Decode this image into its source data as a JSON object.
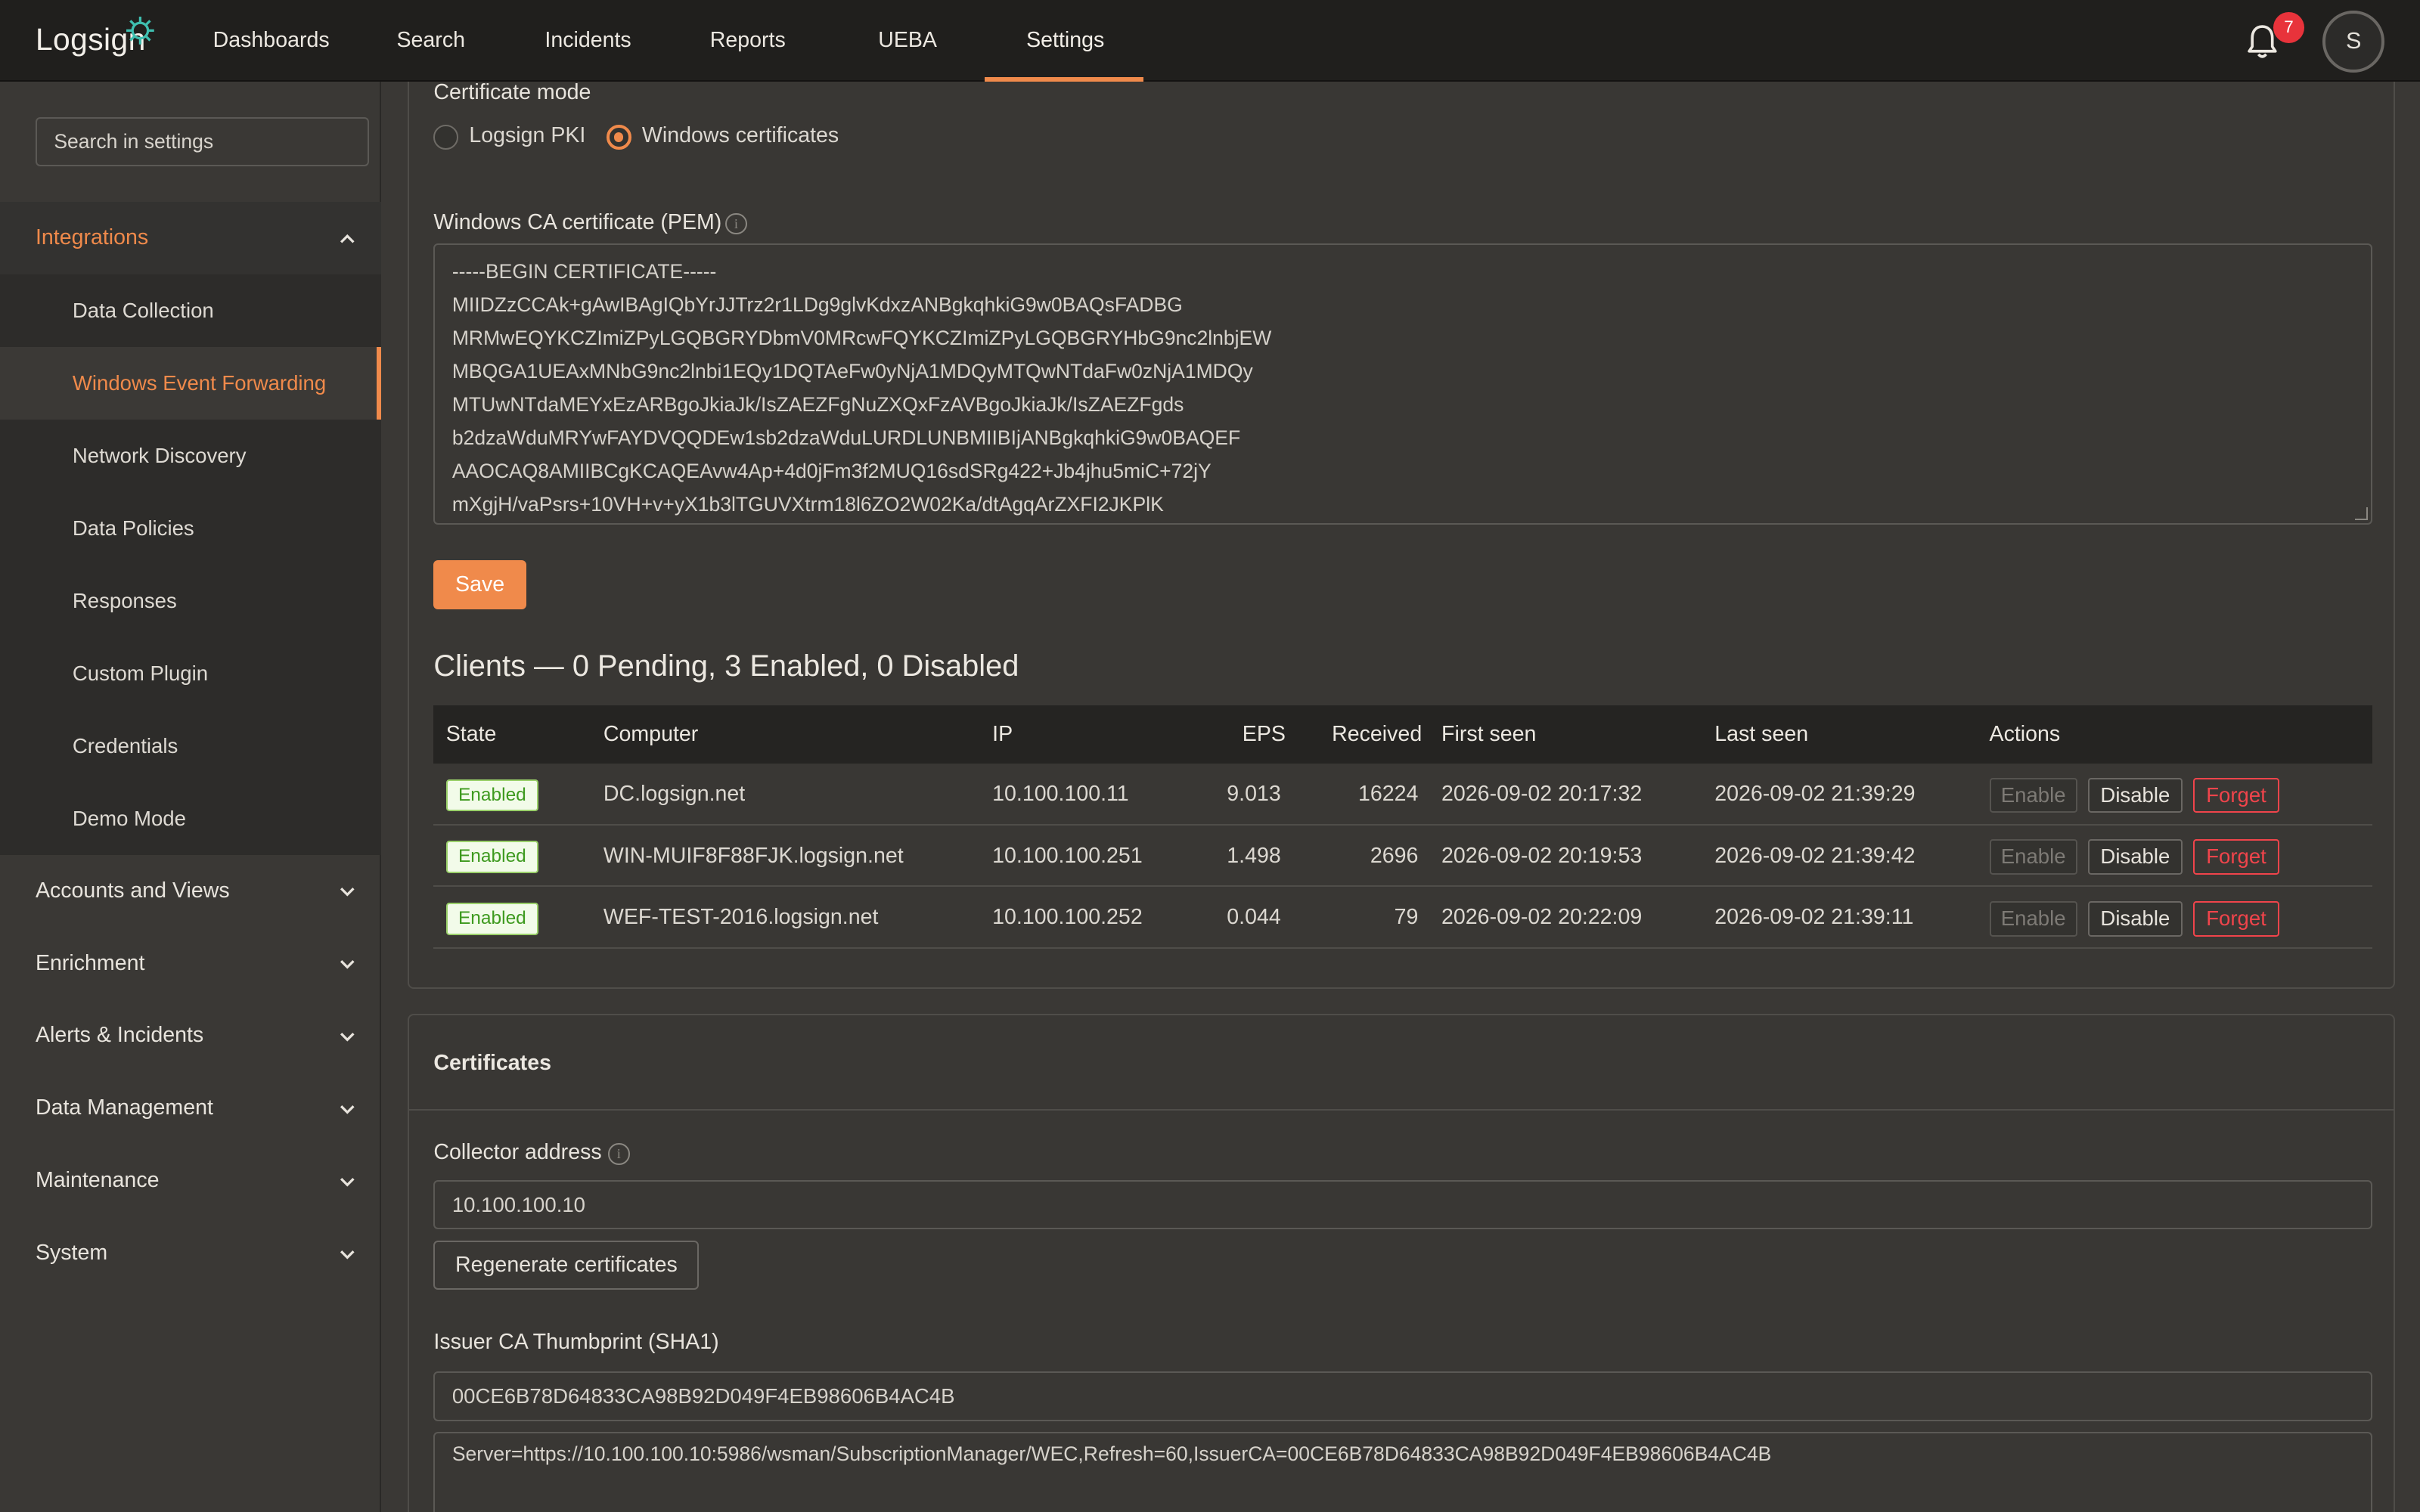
{
  "app": {
    "logo_text": "Logsign",
    "notifications_count": "7",
    "user_initial": "S"
  },
  "nav": {
    "items": [
      "Dashboards",
      "Search",
      "Incidents",
      "Reports",
      "UEBA",
      "Settings"
    ],
    "active": "Settings"
  },
  "sidebar": {
    "search_placeholder": "Search in settings",
    "integrations_label": "Integrations",
    "integrations_items": [
      "Data Collection",
      "Windows Event Forwarding",
      "Network Discovery",
      "Data Policies",
      "Responses",
      "Custom Plugin",
      "Credentials",
      "Demo Mode"
    ],
    "groups": [
      "Accounts and Views",
      "Enrichment",
      "Alerts & Incidents",
      "Data Management",
      "Maintenance",
      "System"
    ]
  },
  "cert_mode": {
    "label": "Certificate mode",
    "option_pki": "Logsign PKI",
    "option_windows": "Windows certificates",
    "selected": "Windows certificates"
  },
  "pem": {
    "label": "Windows CA certificate (PEM)",
    "lines": [
      "-----BEGIN CERTIFICATE-----",
      "MIIDZzCCAk+gAwIBAgIQbYrJJTrz2r1LDg9glvKdxzANBgkqhkiG9w0BAQsFADBG",
      "MRMwEQYKCZImiZPyLGQBGRYDbmV0MRcwFQYKCZImiZPyLGQBGRYHbG9nc2lnbjEW",
      "MBQGA1UEAxMNbG9nc2lnbi1EQy1DQTAeFw0yNjA1MDQyMTQwNTdaFw0zNjA1MDQy",
      "MTUwNTdaMEYxEzARBgoJkiaJk/IsZAEZFgNuZXQxFzAVBgoJkiaJk/IsZAEZFgds",
      "b2dzaWduMRYwFAYDVQQDEw1sb2dzaWduLURDLUNBMIIBIjANBgkqhkiG9w0BAQEF",
      "AAOCAQ8AMIIBCgKCAQEAvw4Ap+4d0jFm3f2MUQ16sdSRg422+Jb4jhu5miC+72jY",
      "mXgjH/vaPsrs+10VH+v+yX1b3lTGUVXtrm18l6ZO2W02Ka/dtAgqArZXFI2JKPlK"
    ]
  },
  "save_label": "Save",
  "clients": {
    "title": "Clients — 0 Pending, 3 Enabled, 0 Disabled",
    "columns": [
      "State",
      "Computer",
      "IP",
      "EPS",
      "Received",
      "First seen",
      "Last seen",
      "Actions"
    ],
    "rows": [
      {
        "state": "Enabled",
        "computer": "DC.logsign.net",
        "ip": "10.100.100.11",
        "eps": "9.013",
        "received": "16224",
        "first_seen": "2026-09-02 20:17:32",
        "last_seen": "2026-09-02 21:39:29"
      },
      {
        "state": "Enabled",
        "computer": "WIN-MUIF8F88FJK.logsign.net",
        "ip": "10.100.100.251",
        "eps": "1.498",
        "received": "2696",
        "first_seen": "2026-09-02 20:19:53",
        "last_seen": "2026-09-02 21:39:42"
      },
      {
        "state": "Enabled",
        "computer": "WEF-TEST-2016.logsign.net",
        "ip": "10.100.100.252",
        "eps": "0.044",
        "received": "79",
        "first_seen": "2026-09-02 20:22:09",
        "last_seen": "2026-09-02 21:39:11"
      }
    ],
    "action_labels": {
      "enable": "Enable",
      "disable": "Disable",
      "forget": "Forget"
    }
  },
  "certificates": {
    "title": "Certificates",
    "collector_label": "Collector address",
    "collector_value": "10.100.100.10",
    "regen_label": "Regenerate certificates",
    "thumb_label": "Issuer CA Thumbprint (SHA1)",
    "thumb_value": "00CE6B78D64833CA98B92D049F4EB98606B4AC4B",
    "subscription": "Server=https://10.100.100.10:5986/wsman/SubscriptionManager/WEC,Refresh=60,IssuerCA=00CE6B78D64833CA98B92D049F4EB98606B4AC4B"
  },
  "colors": {
    "accent": "#f08a4b",
    "danger": "#f0444b",
    "success": "#3e9a1f",
    "topbar": "#201f1d",
    "background": "#3a3835"
  }
}
